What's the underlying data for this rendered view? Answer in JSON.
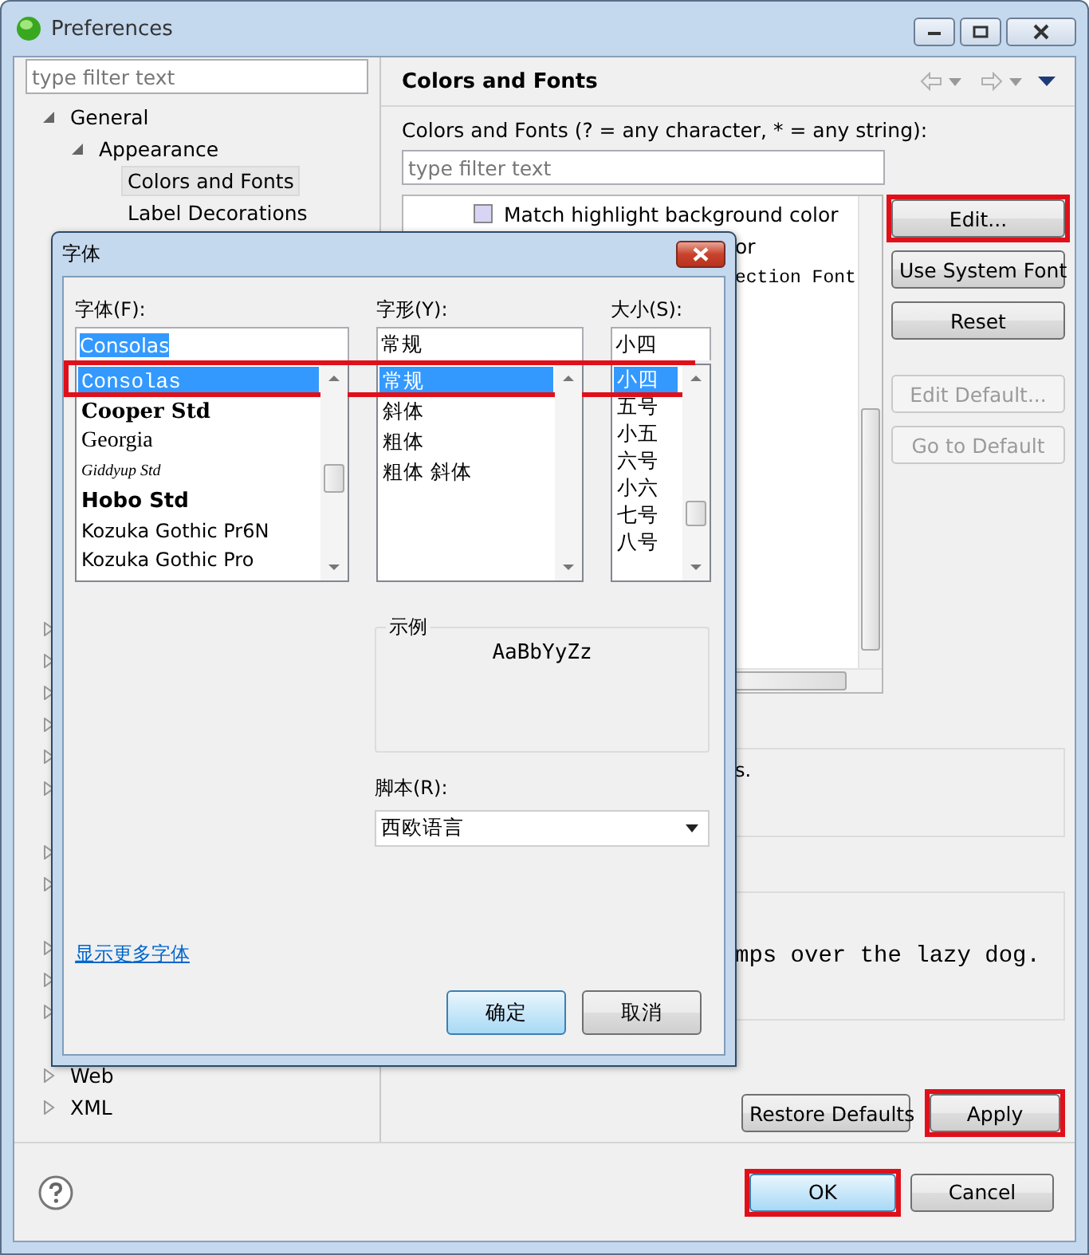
{
  "window": {
    "title": "Preferences"
  },
  "sidebar": {
    "filter": {
      "placeholder": "type filter text"
    },
    "tree": [
      {
        "label": "General",
        "expanded": true,
        "children": [
          {
            "label": "Appearance",
            "expanded": true,
            "children": [
              {
                "label": "Colors and Fonts",
                "selected": true
              },
              {
                "label": "Label Decorations",
                "selected": false
              }
            ]
          }
        ]
      }
    ],
    "covered_rows": [
      {
        "expandable": true
      },
      {
        "expandable": true
      },
      {
        "expandable": true
      },
      {
        "expandable": true
      },
      {
        "expandable": true
      },
      {
        "expandable": true
      },
      {
        "expandable": false
      },
      {
        "expandable": true
      },
      {
        "expandable": true
      },
      {
        "expandable": false
      },
      {
        "expandable": true
      },
      {
        "expandable": true
      },
      {
        "expandable": true
      },
      {
        "expandable": false
      }
    ],
    "tail_rows": [
      {
        "label": "Web",
        "expanded": false
      },
      {
        "label": "XML",
        "expanded": false
      }
    ]
  },
  "page": {
    "title": "Colors and Fonts",
    "filter_label": "Colors and Fonts (? = any character, * = any string):",
    "filter": {
      "placeholder": "type filter text"
    },
    "items": [
      {
        "label": "Match highlight background color",
        "kind": "color",
        "color": "#d8d4f4",
        "covered": false
      },
      {
        "label": "or",
        "kind": "plain",
        "covered": true
      },
      {
        "label": "ection Font",
        "kind": "font",
        "covered": true
      }
    ],
    "side_buttons": [
      {
        "label": "Edit...",
        "disabled": false,
        "highlighted": true
      },
      {
        "label": "Use System Font",
        "disabled": false,
        "highlighted": false
      },
      {
        "label": "Reset",
        "disabled": false,
        "highlighted": false
      },
      {
        "label": "Edit Default...",
        "disabled": true,
        "highlighted": false
      },
      {
        "label": "Go to Default",
        "disabled": true,
        "highlighted": false
      }
    ],
    "description": "s.",
    "preview": "mps over the lazy dog.",
    "buttons": [
      {
        "label": "Restore Defaults",
        "highlighted": false
      },
      {
        "label": "Apply",
        "highlighted": true
      }
    ]
  },
  "footer": {
    "buttons": [
      {
        "label": "OK",
        "default": true,
        "highlighted": true
      },
      {
        "label": "Cancel",
        "default": false,
        "highlighted": false
      }
    ]
  },
  "font_dialog": {
    "title": "字体",
    "highlight_selection": true,
    "font": {
      "label": "字体(F):",
      "value": "Consolas",
      "items": [
        {
          "label": "Consolas",
          "kind": "mono",
          "selected": true
        },
        {
          "label": "Cooper Std",
          "kind": "heavy-serif",
          "selected": false
        },
        {
          "label": "Georgia",
          "kind": "serif",
          "selected": false
        },
        {
          "label": "Giddyup Std",
          "kind": "script",
          "selected": false
        },
        {
          "label": "Hobo Std",
          "kind": "heavy",
          "selected": false
        },
        {
          "label": "Kozuka Gothic Pr6N",
          "kind": "sans",
          "selected": false
        },
        {
          "label": "Kozuka Gothic Pro",
          "kind": "sans",
          "selected": false
        }
      ]
    },
    "style": {
      "label": "字形(Y):",
      "value": "常规",
      "items": [
        {
          "label": "常规",
          "selected": true
        },
        {
          "label": "斜体",
          "selected": false
        },
        {
          "label": "粗体",
          "selected": false
        },
        {
          "label": "粗体 斜体",
          "selected": false
        }
      ]
    },
    "size": {
      "label": "大小(S):",
      "value": "小四",
      "items": [
        {
          "label": "小四",
          "selected": true
        },
        {
          "label": "五号",
          "selected": false
        },
        {
          "label": "小五",
          "selected": false
        },
        {
          "label": "六号",
          "selected": false
        },
        {
          "label": "小六",
          "selected": false
        },
        {
          "label": "七号",
          "selected": false
        },
        {
          "label": "八号",
          "selected": false
        }
      ]
    },
    "sample": {
      "label": "示例",
      "text": "AaBbYyZz"
    },
    "script": {
      "label": "脚本(R):",
      "value": "西欧语言"
    },
    "more_link": "显示更多字体",
    "buttons": [
      {
        "label": "确定",
        "default": true
      },
      {
        "label": "取消",
        "default": false
      }
    ]
  }
}
